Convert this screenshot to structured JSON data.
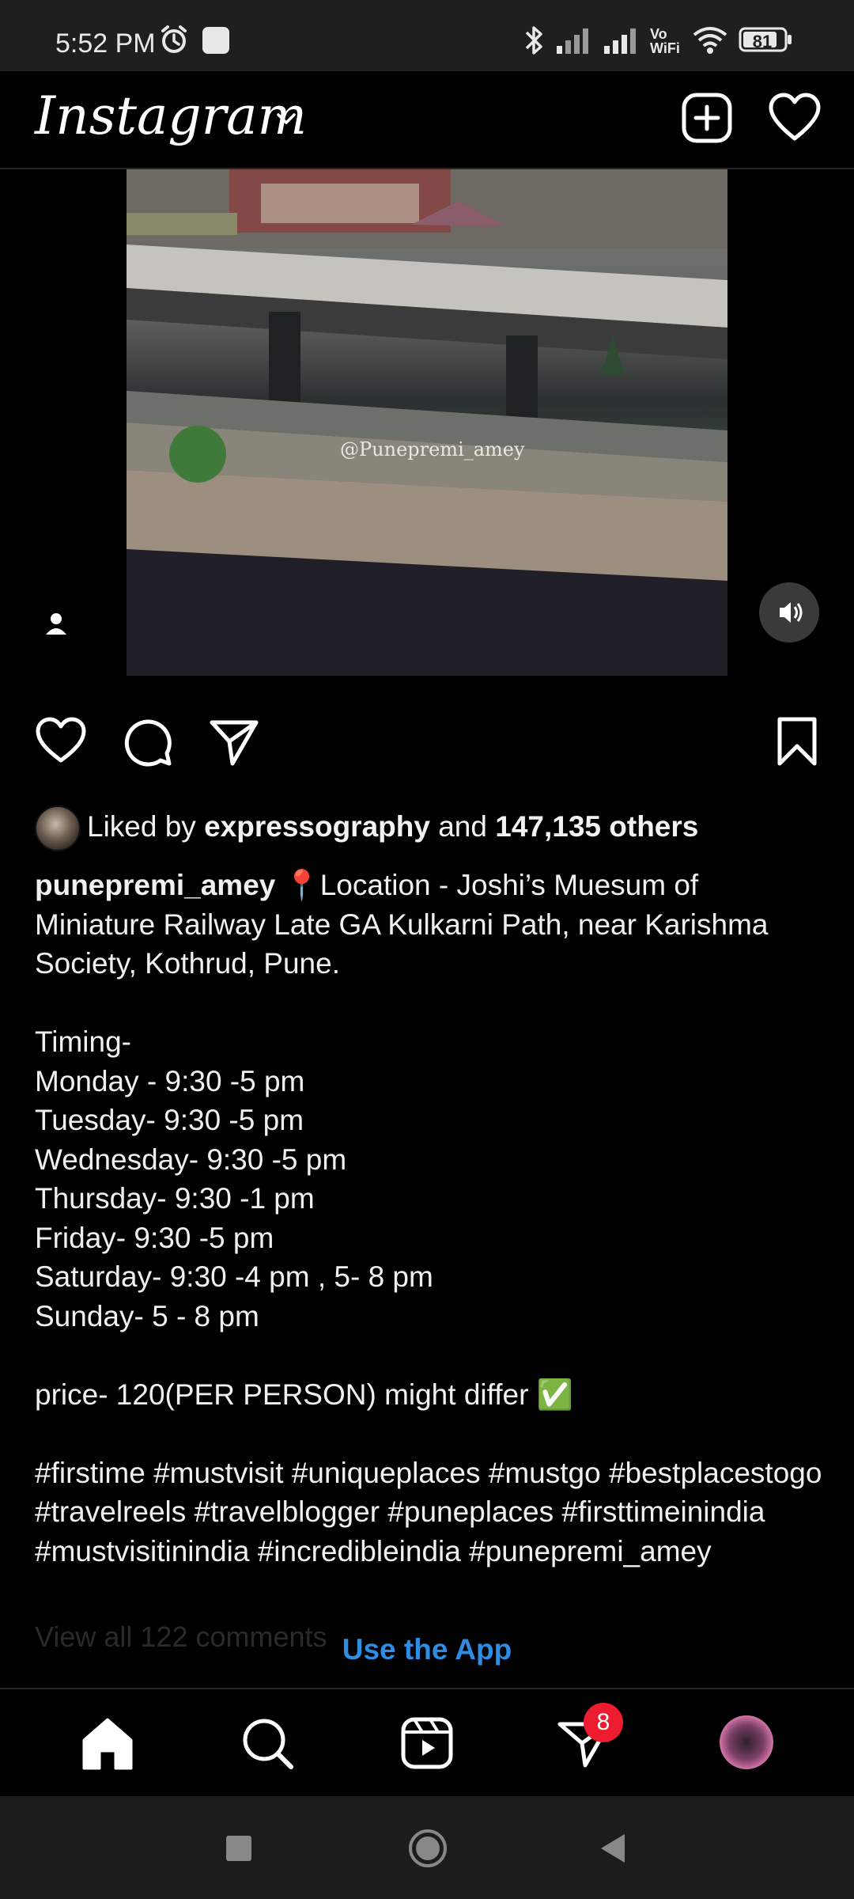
{
  "status_bar": {
    "time": "5:52 PM",
    "battery": "81",
    "icons": [
      "alarm-icon",
      "notification-square-icon",
      "bluetooth-icon",
      "signal-icon",
      "signal-icon",
      "vowifi-icon",
      "wifi-icon",
      "battery-icon"
    ],
    "vowifi_label": "Vo WiFi"
  },
  "header": {
    "logo": "Instagram",
    "icons": [
      "chevron-down-icon",
      "new-post-icon",
      "heart-icon"
    ]
  },
  "media": {
    "watermark": "@Punepremi_amey",
    "icons": [
      "user-tag-icon",
      "volume-icon"
    ]
  },
  "actions": {
    "icons": [
      "like-icon",
      "comment-icon",
      "share-icon",
      "save-icon"
    ]
  },
  "likes": {
    "prefix": "Liked by ",
    "user": "expressography",
    "middle": " and ",
    "count": "147,135 others"
  },
  "caption": {
    "username": "punepremi_amey",
    "pin": "📍",
    "text": "Location - Joshi’s Muesum of Miniature Railway Late GA Kulkarni Path, near Karishma Society, Kothrud, Pune.\n\nTiming-\nMonday - 9:30 -5 pm\nTuesday- 9:30 -5 pm\nWednesday- 9:30 -5 pm\nThursday- 9:30 -1 pm\nFriday- 9:30 -5 pm\nSaturday- 9:30 -4 pm , 5- 8 pm\nSunday- 5 - 8 pm\n\nprice- 120(PER PERSON) might differ ✅\n\n#firstime #mustvisit #uniqueplaces #mustgo #bestplacestogo #travelreels #travelblogger #puneplaces #firsttimeinindia #mustvisitinindia #incredibleindia #punepremi_amey"
  },
  "comments_link": "View all 122 comments",
  "use_app": "Use the App",
  "bottom_nav": {
    "icons": [
      "home-icon",
      "search-icon",
      "reels-icon",
      "activity-icon",
      "profile-avatar"
    ],
    "badge_count": "8"
  },
  "android_nav": {
    "icons": [
      "recents-icon",
      "home-circle-icon",
      "back-icon"
    ]
  },
  "colors": {
    "background": "#000000",
    "accent_link": "#2f8de4",
    "badge": "#ed1c2e"
  }
}
